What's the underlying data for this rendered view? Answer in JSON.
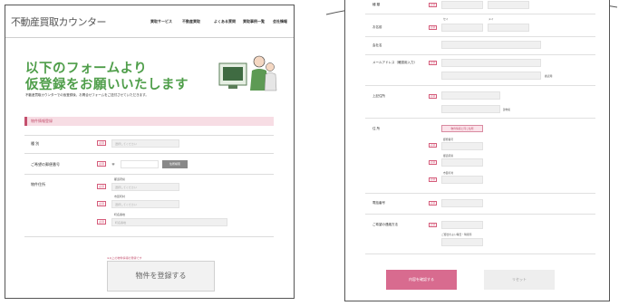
{
  "left": {
    "logo": "不動産買取カウンター",
    "nav": [
      "買取サービス",
      "不動産買取",
      "よくある質問",
      "買取事例一覧",
      "会社情報"
    ],
    "hero_line1": "以下のフォームより",
    "hero_line2": "仮登録をお願いいたします",
    "hero_sub": "不動産買取カウンターでの仮登録後、お問合せフォームをご送付させていただきます。",
    "section_title": "物件情報登録",
    "rows": [
      {
        "label": "種 別",
        "required": "必須",
        "field": "選択してください"
      },
      {
        "label": "ご希望の郵便番号",
        "required": "必須",
        "postal_mark": "〒",
        "button": "住所検索"
      },
      {
        "label": "物件住所",
        "required": "必須",
        "subs": [
          {
            "caption": "都道府県",
            "field": "選択してください"
          },
          {
            "caption": "市区町村",
            "field": "選択してください"
          },
          {
            "caption": "町名番地",
            "field": "町名番地"
          }
        ]
      }
    ],
    "note": "※以上の物件情報の登録です",
    "submit": "物件を登録する"
  },
  "right": {
    "rows": [
      {
        "label": "種 類",
        "required": "必須"
      },
      {
        "label": "お名前",
        "required": "必須",
        "sub1": "セイ",
        "sub2": "メイ"
      },
      {
        "label": "会社名",
        "required": "任意"
      },
      {
        "label": "メールアドレス（確認用入力）",
        "required": "必須",
        "tail": "確認用"
      },
      {
        "label": "上記住所",
        "required": "必須",
        "tail": "建物名"
      },
      {
        "label": "住 所",
        "required": "必須",
        "pill": "物件情報と同じ住所",
        "subs": [
          "郵便番号",
          "都道府県",
          "市区町村"
        ]
      },
      {
        "label": "電話番号",
        "required": "必須"
      },
      {
        "label": "ご希望の連絡方法",
        "required": "必須",
        "sub": "ご都合のよい曜日・時間帯"
      }
    ],
    "confirm": "内容を確認する",
    "reset": "リセット"
  }
}
